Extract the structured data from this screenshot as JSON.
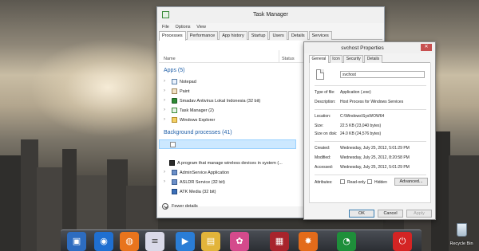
{
  "task_manager": {
    "title": "Task Manager",
    "menu": [
      "File",
      "Options",
      "View"
    ],
    "tabs": [
      "Processes",
      "Performance",
      "App history",
      "Startup",
      "Users",
      "Details",
      "Services"
    ],
    "active_tab": "Processes",
    "columns": {
      "name": "Name",
      "status": "Status"
    },
    "apps_header": "Apps (5)",
    "apps": [
      {
        "label": "Notepad",
        "icon": "notepad-icon"
      },
      {
        "label": "Paint",
        "icon": "paint-icon"
      },
      {
        "label": "Smadav Antivirus Lokal Indonesia (32 bit)",
        "icon": "smadav-icon"
      },
      {
        "label": "Task Manager (2)",
        "icon": "task-manager-icon"
      },
      {
        "label": "Windows Explorer",
        "icon": "folder-icon"
      }
    ],
    "bg_header": "Background processes (41)",
    "bg_processes": [
      {
        "label": "",
        "icon": "blank-process-icon",
        "selected": true,
        "expandable": false
      },
      {
        "label": "A program that manage wireless devices in system (...",
        "icon": "wireless-icon",
        "selected": false,
        "expandable": false
      },
      {
        "label": "AdminService Application",
        "icon": "admin-service-icon",
        "selected": false,
        "expandable": true
      },
      {
        "label": "ASLDR Service (32 bit)",
        "icon": "asldr-icon",
        "selected": false,
        "expandable": true
      },
      {
        "label": "ATK Media (32 bit)",
        "icon": "atk-media-icon",
        "selected": false,
        "expandable": false
      }
    ],
    "footer": "Fewer details"
  },
  "properties": {
    "title": "svchost Properties",
    "close_glyph": "✕",
    "tabs": [
      "General",
      "Icon",
      "Security",
      "Details"
    ],
    "active_tab": "General",
    "file_name": "svchost",
    "type_label": "Type of file:",
    "type_value": "Application (.exe)",
    "desc_label": "Description:",
    "desc_value": "Host Process for Windows Services",
    "location_label": "Location:",
    "location_value": "C:\\Windows\\SysWOW64",
    "size_label": "Size:",
    "size_value": "22.5 KB (23,040 bytes)",
    "size_disk_label": "Size on disk:",
    "size_disk_value": "24.0 KB (24,576 bytes)",
    "created_label": "Created:",
    "created_value": "Wednesday, July 25, 2012, 5:01:29 PM",
    "modified_label": "Modified:",
    "modified_value": "Wednesday, July 25, 2012, 8:20:58 PM",
    "accessed_label": "Accessed:",
    "accessed_value": "Wednesday, July 25, 2012, 5:01:29 PM",
    "attributes_label": "Attributes:",
    "read_only": "Read-only",
    "hidden": "Hidden",
    "advanced": "Advanced...",
    "ok": "OK",
    "cancel": "Cancel",
    "apply": "Apply"
  },
  "desktop": {
    "recycle_bin": "Recycle Bin",
    "dock_icons": [
      {
        "name": "monitor-icon",
        "color": "#2d6cc0",
        "glyph": "▣"
      },
      {
        "name": "globe-icon",
        "color": "#1f6fd1",
        "glyph": "◉"
      },
      {
        "name": "firefox-icon",
        "color": "#e8741d",
        "glyph": "◍"
      },
      {
        "name": "notes-icon",
        "color": "#d9d9e8",
        "glyph": "≡"
      },
      {
        "name": "media-player-icon",
        "color": "#2a7dd6",
        "glyph": "▶"
      },
      {
        "name": "files-icon",
        "color": "#e2b43a",
        "glyph": "▤"
      },
      {
        "name": "picasa-icon",
        "color": "#d44a8c",
        "glyph": "✿"
      },
      {
        "name": "winrar-icon",
        "color": "#a8242c",
        "glyph": "▦"
      },
      {
        "name": "tools-icon",
        "color": "#e36b1a",
        "glyph": "✸"
      },
      {
        "name": "speedometer-icon",
        "color": "#1e8f3a",
        "glyph": "◔"
      },
      {
        "name": "power-icon",
        "color": "#d42424",
        "glyph": "⏻"
      }
    ]
  }
}
